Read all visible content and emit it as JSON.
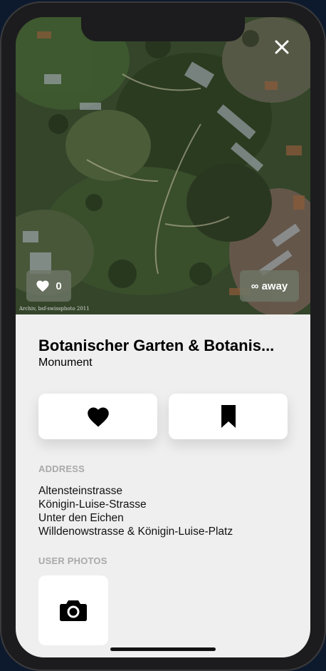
{
  "hero": {
    "credit": "Archiv, bsf-swissphoto 2011",
    "likes_count": "0",
    "distance_label": "∞ away"
  },
  "place": {
    "title": "Botanischer Garten & Botanis...",
    "category": "Monument"
  },
  "address": {
    "heading": "ADDRESS",
    "lines": [
      "Altensteinstrasse",
      "Königin-Luise-Strasse",
      "Unter den Eichen",
      "Willdenowstrasse & Königin-Luise-Platz"
    ]
  },
  "photos": {
    "heading": "USER PHOTOS"
  },
  "icons": {
    "close": "close-icon",
    "like": "heart-icon",
    "bookmark": "bookmark-icon",
    "camera": "camera-icon"
  },
  "colors": {
    "card_background": "#efefef",
    "section_label": "#a9a9a9",
    "pill_background": "#6e7666"
  }
}
